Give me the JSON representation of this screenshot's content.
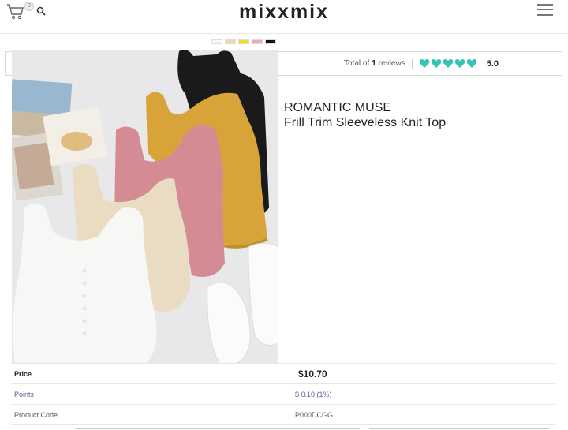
{
  "header": {
    "logo": "mixxmix",
    "cart_count": "0",
    "icons": [
      "cart-icon",
      "search-icon",
      "hamburger-menu-icon"
    ]
  },
  "swatches": [
    "#fbf8ec",
    "#f0d5b5",
    "#f5df1a",
    "#f2a7b7",
    "#111111"
  ],
  "reviews": {
    "prefix": "Total of",
    "count": "1",
    "suffix": "reviews",
    "rating": 5,
    "score": "5.0",
    "heart_color": "#35c3b5"
  },
  "product": {
    "brand": "ROMANTIC MUSE",
    "name": "Frill Trim Sleeveless Knit Top",
    "image_alt": "Frill trim knit tops in white, beige, pink, mustard and black with flip-flops"
  },
  "info": {
    "price_label": "Price",
    "price_value": "$10.70",
    "points_label": "Points",
    "points_value": "$ 0.10 (1%)",
    "code_label": "Product Code",
    "code_value": "P000DCGG"
  }
}
